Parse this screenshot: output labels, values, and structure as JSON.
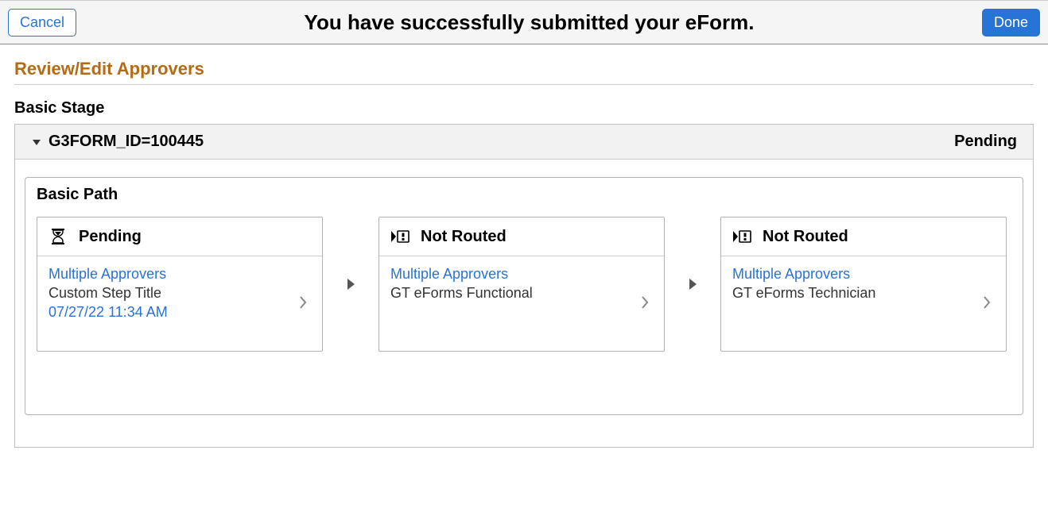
{
  "header": {
    "cancel_label": "Cancel",
    "title": "You have successfully submitted your eForm.",
    "done_label": "Done"
  },
  "section_title": "Review/Edit Approvers",
  "stage": {
    "title": "Basic Stage",
    "id_label": "G3FORM_ID=100445",
    "overall_status": "Pending"
  },
  "path": {
    "title": "Basic Path",
    "steps": [
      {
        "status": "Pending",
        "icon": "hourglass",
        "approvers_link": "Multiple Approvers",
        "subtitle": "Custom Step Title",
        "timestamp": "07/27/22 11:34 AM"
      },
      {
        "status": "Not Routed",
        "icon": "not-routed",
        "approvers_link": "Multiple Approvers",
        "subtitle": "GT eForms Functional",
        "timestamp": ""
      },
      {
        "status": "Not Routed",
        "icon": "not-routed",
        "approvers_link": "Multiple Approvers",
        "subtitle": "GT eForms Technician",
        "timestamp": ""
      }
    ]
  }
}
